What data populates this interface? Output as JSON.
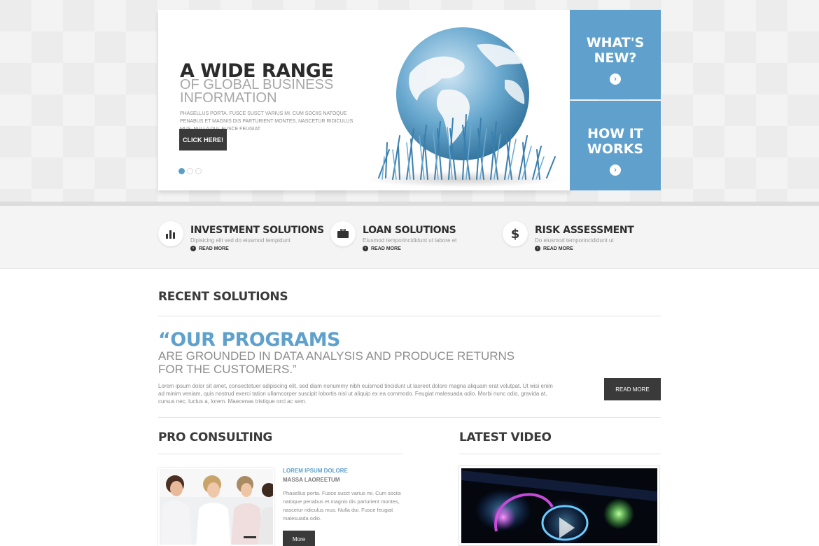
{
  "hero": {
    "title": "A WIDE RANGE",
    "subtitle": "OF GLOBAL BUSINESS INFORMATION",
    "text": "PHASELLUS PORTA. FUSCE SUSCT VARIUS MI. CUM SOCIIS NATOQUE PENABUS ET MAGNIS DIS PARTURIENT MONTES, NASCETUR RIDICULUS MUS. NULLA DUI. FUSCE FEUGIAT",
    "button_label": "CLICK HERE!",
    "slides_total": 3,
    "slide_active": 1
  },
  "tiles": [
    {
      "label": "WHAT'S NEW?",
      "icon": "chevron-right-icon"
    },
    {
      "label": "HOW IT WORKS",
      "icon": "chevron-right-icon"
    }
  ],
  "services": [
    {
      "title": "INVESTMENT SOLUTIONS",
      "desc": "Dipisicing elit sed do eiusmod tempidunt",
      "more": "READ MORE",
      "icon": "bar-chart-icon"
    },
    {
      "title": "LOAN SOLUTIONS",
      "desc": "Eiusmod temporincididunt ut labore et",
      "more": "READ MORE",
      "icon": "briefcase-icon"
    },
    {
      "title": "RISK ASSESSMENT",
      "desc": "Do eiusmod temporincididunt ut",
      "more": "READ MORE",
      "icon": "dollar-icon"
    }
  ],
  "recent": {
    "title": "RECENT SOLUTIONS",
    "quote_head": "“OUR PROGRAMS",
    "quote_sub": "ARE GROUNDED IN DATA ANALYSIS AND PRODUCE RETURNS FOR THE CUSTOMERS.”",
    "text": "Lorem ipsum dolor sit amet, consectetuer adipiscing elit, sed diam nonummy nibh euismod tincidunt ut laoreet dolore magna aliquam erat volutpat. Ut wisi enim ad minim veniam, quis nostrud exerci tation ullamcorper suscipit lobortis nisl ut aliquip ex ea commodo. Feugiat malesuada odio. Morbi nunc odio, gravida at, cursus nec, luctus a, lorem. Maecenas tristique orci ac sem.",
    "button_label": "READ MORE"
  },
  "consulting": {
    "title": "PRO CONSULTING",
    "heading": "LOREM IPSUM DOLORE",
    "sub": "MASSA LAOREETUM",
    "text": "Phasellus porta. Fusce susct varius mi. Cum sociis natoque penabus et magnis dis parturient montes, nascetur ridiculus mus. Nulla dui. Fusce feugiat malesuada odio.",
    "button_label": "More"
  },
  "video": {
    "title": "LATEST VIDEO"
  },
  "colors": {
    "accent": "#5fa1cc",
    "dark_button": "#3a3a3a",
    "heading": "#3a3a3a"
  }
}
